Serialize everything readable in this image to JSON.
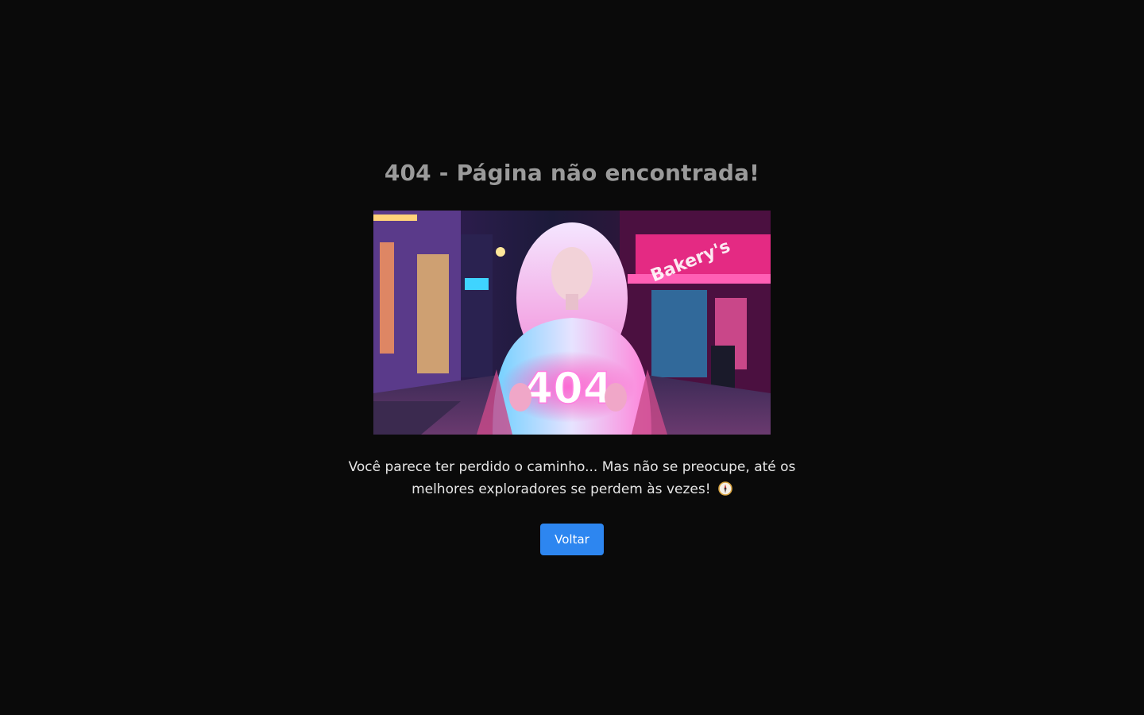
{
  "page": {
    "title": "404 - Página não encontrada!",
    "message_line1": "Você parece ter perdido o caminho... Mas não se preocupe, até os",
    "message_line2": "melhores exploradores se perdem às vezes!",
    "message_icon": "compass-icon",
    "back_button_label": "Voltar"
  },
  "hero_image": {
    "sign_text": "404",
    "storefront_text": "Bakery's"
  },
  "colors": {
    "background": "#0a0a0a",
    "title": "#9a9a9a",
    "text": "#e6e6e6",
    "button": "#2d86f0",
    "neon_pink": "#ff2fa8",
    "neon_purple": "#8a3cff"
  }
}
